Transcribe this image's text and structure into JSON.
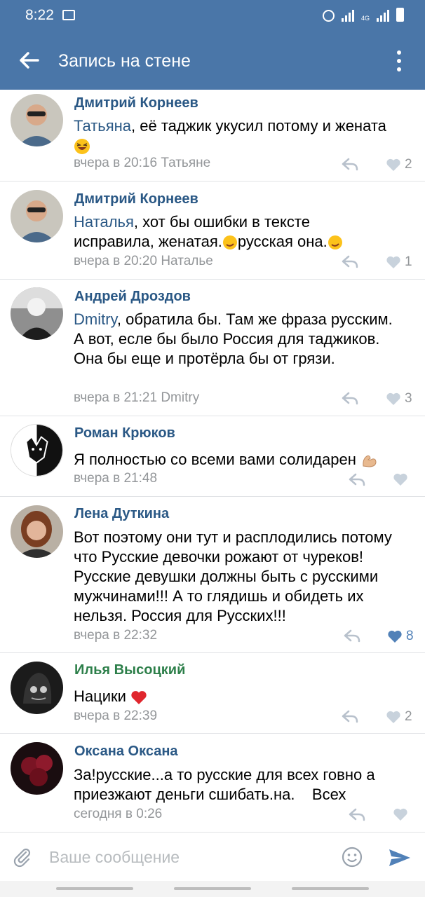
{
  "status_bar": {
    "time": "8:22",
    "network": "4G"
  },
  "header": {
    "title": "Запись на стене"
  },
  "comments": [
    {
      "author": "Дмитрий Корнеев",
      "mention": "Татьяна",
      "text": ", её таджик укусил потому и жената",
      "time": "вчера в 20:16",
      "reply_to": "Татьяне",
      "likes": "2"
    },
    {
      "author": "Дмитрий Корнеев",
      "mention": "Наталья",
      "text_line1": ", хот бы ошибки в тексте",
      "text_line2a": "исправила, женатая.",
      "text_line2b": "русская она.",
      "time": "вчера в 20:20",
      "reply_to": "Наталье",
      "likes": "1"
    },
    {
      "author": "Андрей Дроздов",
      "mention": "Dmitry",
      "text": ", обратила бы. Там же фраза русским. А вот, есле бы было Россия для таджиков. Она бы еще и протёрла бы от грязи.",
      "time": "вчера в 21:21",
      "reply_to": "Dmitry",
      "likes": "3"
    },
    {
      "author": "Роман Крюков",
      "text": "Я полностью со всеми вами солидарен",
      "time": "вчера в 21:48",
      "likes": ""
    },
    {
      "author": "Лена Дуткина",
      "text": "Вот поэтому они тут и расплодились потому что Русские девочки рожают от чуреков! Русские девушки должны быть с русскими мужчинами!!! А то глядишь и обидеть их нельзя. Россия для Русских!!!",
      "time": "вчера в 22:32",
      "likes": "8"
    },
    {
      "author": "Илья Высоцкий",
      "text": "Нацики",
      "time": "вчера в 22:39",
      "likes": "2"
    },
    {
      "author": "Оксана Оксана",
      "text_line1": "За!русские...а то русские для всех говно а",
      "text_line2": "приезжают деньги сшибать.на.    Всех",
      "time": "сегодня в 0:26",
      "likes": ""
    }
  ],
  "composer": {
    "placeholder": "Ваше сообщение"
  },
  "colors": {
    "header": "#4a76a8",
    "link": "#2a5885",
    "meta": "#939699",
    "like_active": "#5181b8"
  },
  "icons": [
    "back-arrow-icon",
    "more-vertical-icon",
    "reply-icon",
    "heart-icon",
    "attach-icon",
    "smile-icon",
    "send-icon"
  ]
}
